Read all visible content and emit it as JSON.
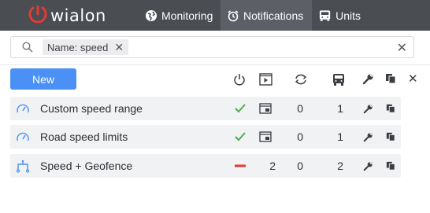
{
  "app": {
    "logo_text": "wialon"
  },
  "nav": {
    "monitoring": "Monitoring",
    "notifications": "Notifications",
    "units": "Units"
  },
  "search": {
    "filter_chip": "Name: speed"
  },
  "toolbar": {
    "new_label": "New"
  },
  "rows": [
    {
      "name": "Custom speed range",
      "status": "enabled",
      "actions": "",
      "triggered": "0",
      "units": "1",
      "icon": "speedometer-icon"
    },
    {
      "name": "Road speed limits",
      "status": "enabled",
      "actions": "",
      "triggered": "0",
      "units": "1",
      "icon": "speedometer-icon"
    },
    {
      "name": "Speed + Geofence",
      "status": "disabled",
      "actions": "2",
      "triggered": "0",
      "units": "2",
      "icon": "geofence-route-icon"
    }
  ],
  "colors": {
    "topbar": "#4a4d52",
    "accent": "#4a90f5",
    "enabled": "#4caf50",
    "disabled": "#e53935",
    "logo_red": "#e53935"
  }
}
